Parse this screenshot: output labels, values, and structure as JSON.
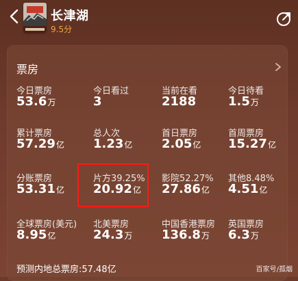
{
  "header": {
    "title": "长津湖",
    "rating": "9.5分",
    "back_icon": "back-chevron-icon",
    "share_icon": "share-icon",
    "poster_text": "长津湖"
  },
  "box_office": {
    "section_title": "票房",
    "stats": [
      {
        "label": "今日票房",
        "value": "53.6",
        "unit": "万"
      },
      {
        "label": "今日看过",
        "value": "3",
        "unit": ""
      },
      {
        "label": "当前在看",
        "value": "2188",
        "unit": ""
      },
      {
        "label": "今日待看",
        "value": "1.5",
        "unit": "万"
      },
      {
        "label": "累计票房",
        "value": "57.29",
        "unit": "亿"
      },
      {
        "label": "总人次",
        "value": "1.23",
        "unit": "亿"
      },
      {
        "label": "首日票房",
        "value": "2.05",
        "unit": "亿"
      },
      {
        "label": "首周票房",
        "value": "15.27",
        "unit": "亿"
      },
      {
        "label": "分账票房",
        "value": "53.31",
        "unit": "亿"
      },
      {
        "label": "片方39.25%",
        "value": "20.92",
        "unit": "亿"
      },
      {
        "label": "影院52.27%",
        "value": "27.86",
        "unit": "亿"
      },
      {
        "label": "其他8.48%",
        "value": "4.51",
        "unit": "亿"
      },
      {
        "label": "全球票房(美元)",
        "value": "8.95",
        "unit": "亿"
      },
      {
        "label": "北美票房",
        "value": "24.3",
        "unit": "万"
      },
      {
        "label": "中国香港票房",
        "value": "136.8",
        "unit": "万"
      },
      {
        "label": "英国票房",
        "value": "6.3",
        "unit": "万"
      }
    ],
    "forecast": "预测内地总票房:57.48亿"
  },
  "watermark": "百家号/孤烟",
  "colors": {
    "background": "#6b3a2c",
    "card": "#7c4937",
    "rating": "#f0a640",
    "highlight": "#ff1a14"
  }
}
